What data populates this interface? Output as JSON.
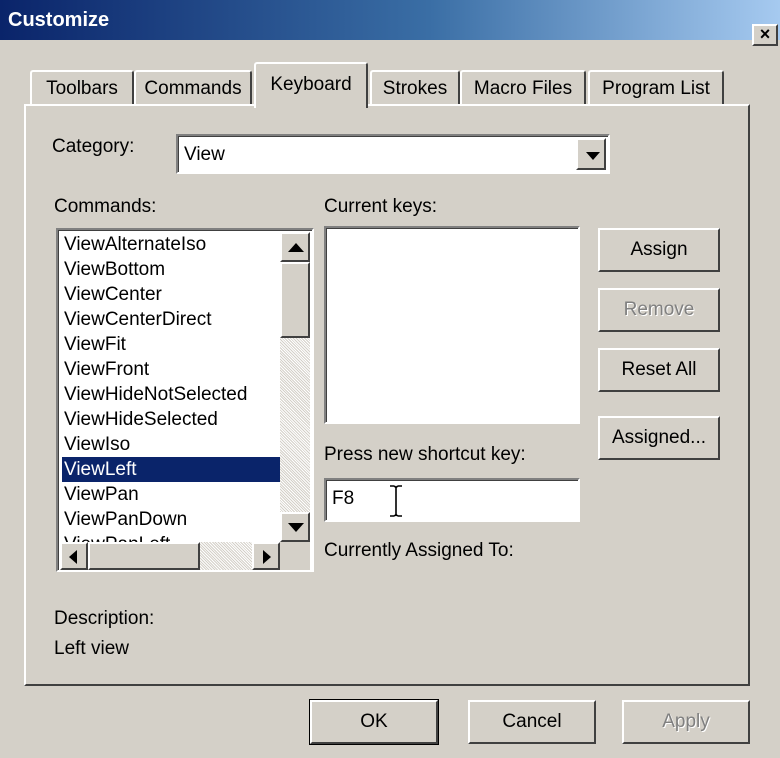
{
  "window": {
    "title": "Customize",
    "close_label": "×"
  },
  "tabs": [
    {
      "label": "Toolbars"
    },
    {
      "label": "Commands"
    },
    {
      "label": "Keyboard"
    },
    {
      "label": "Strokes"
    },
    {
      "label": "Macro Files"
    },
    {
      "label": "Program List"
    }
  ],
  "category": {
    "label": "Category:",
    "value": "View"
  },
  "commands": {
    "label": "Commands:",
    "items": [
      "ViewAlternateIso",
      "ViewBottom",
      "ViewCenter",
      "ViewCenterDirect",
      "ViewFit",
      "ViewFront",
      "ViewHideNotSelected",
      "ViewHideSelected",
      "ViewIso",
      "ViewLeft",
      "ViewPan",
      "ViewPanDown",
      "ViewPanLeft"
    ],
    "selected": "ViewLeft"
  },
  "current_keys": {
    "label": "Current keys:"
  },
  "shortcut": {
    "label": "Press new shortcut key:",
    "value": "F8"
  },
  "assigned_to": {
    "label": "Currently Assigned To:"
  },
  "description": {
    "label": "Description:",
    "text": "Left view"
  },
  "buttons": {
    "assign": "Assign",
    "remove": "Remove",
    "reset_all": "Reset All",
    "assigned": "Assigned...",
    "ok": "OK",
    "cancel": "Cancel",
    "apply": "Apply"
  }
}
